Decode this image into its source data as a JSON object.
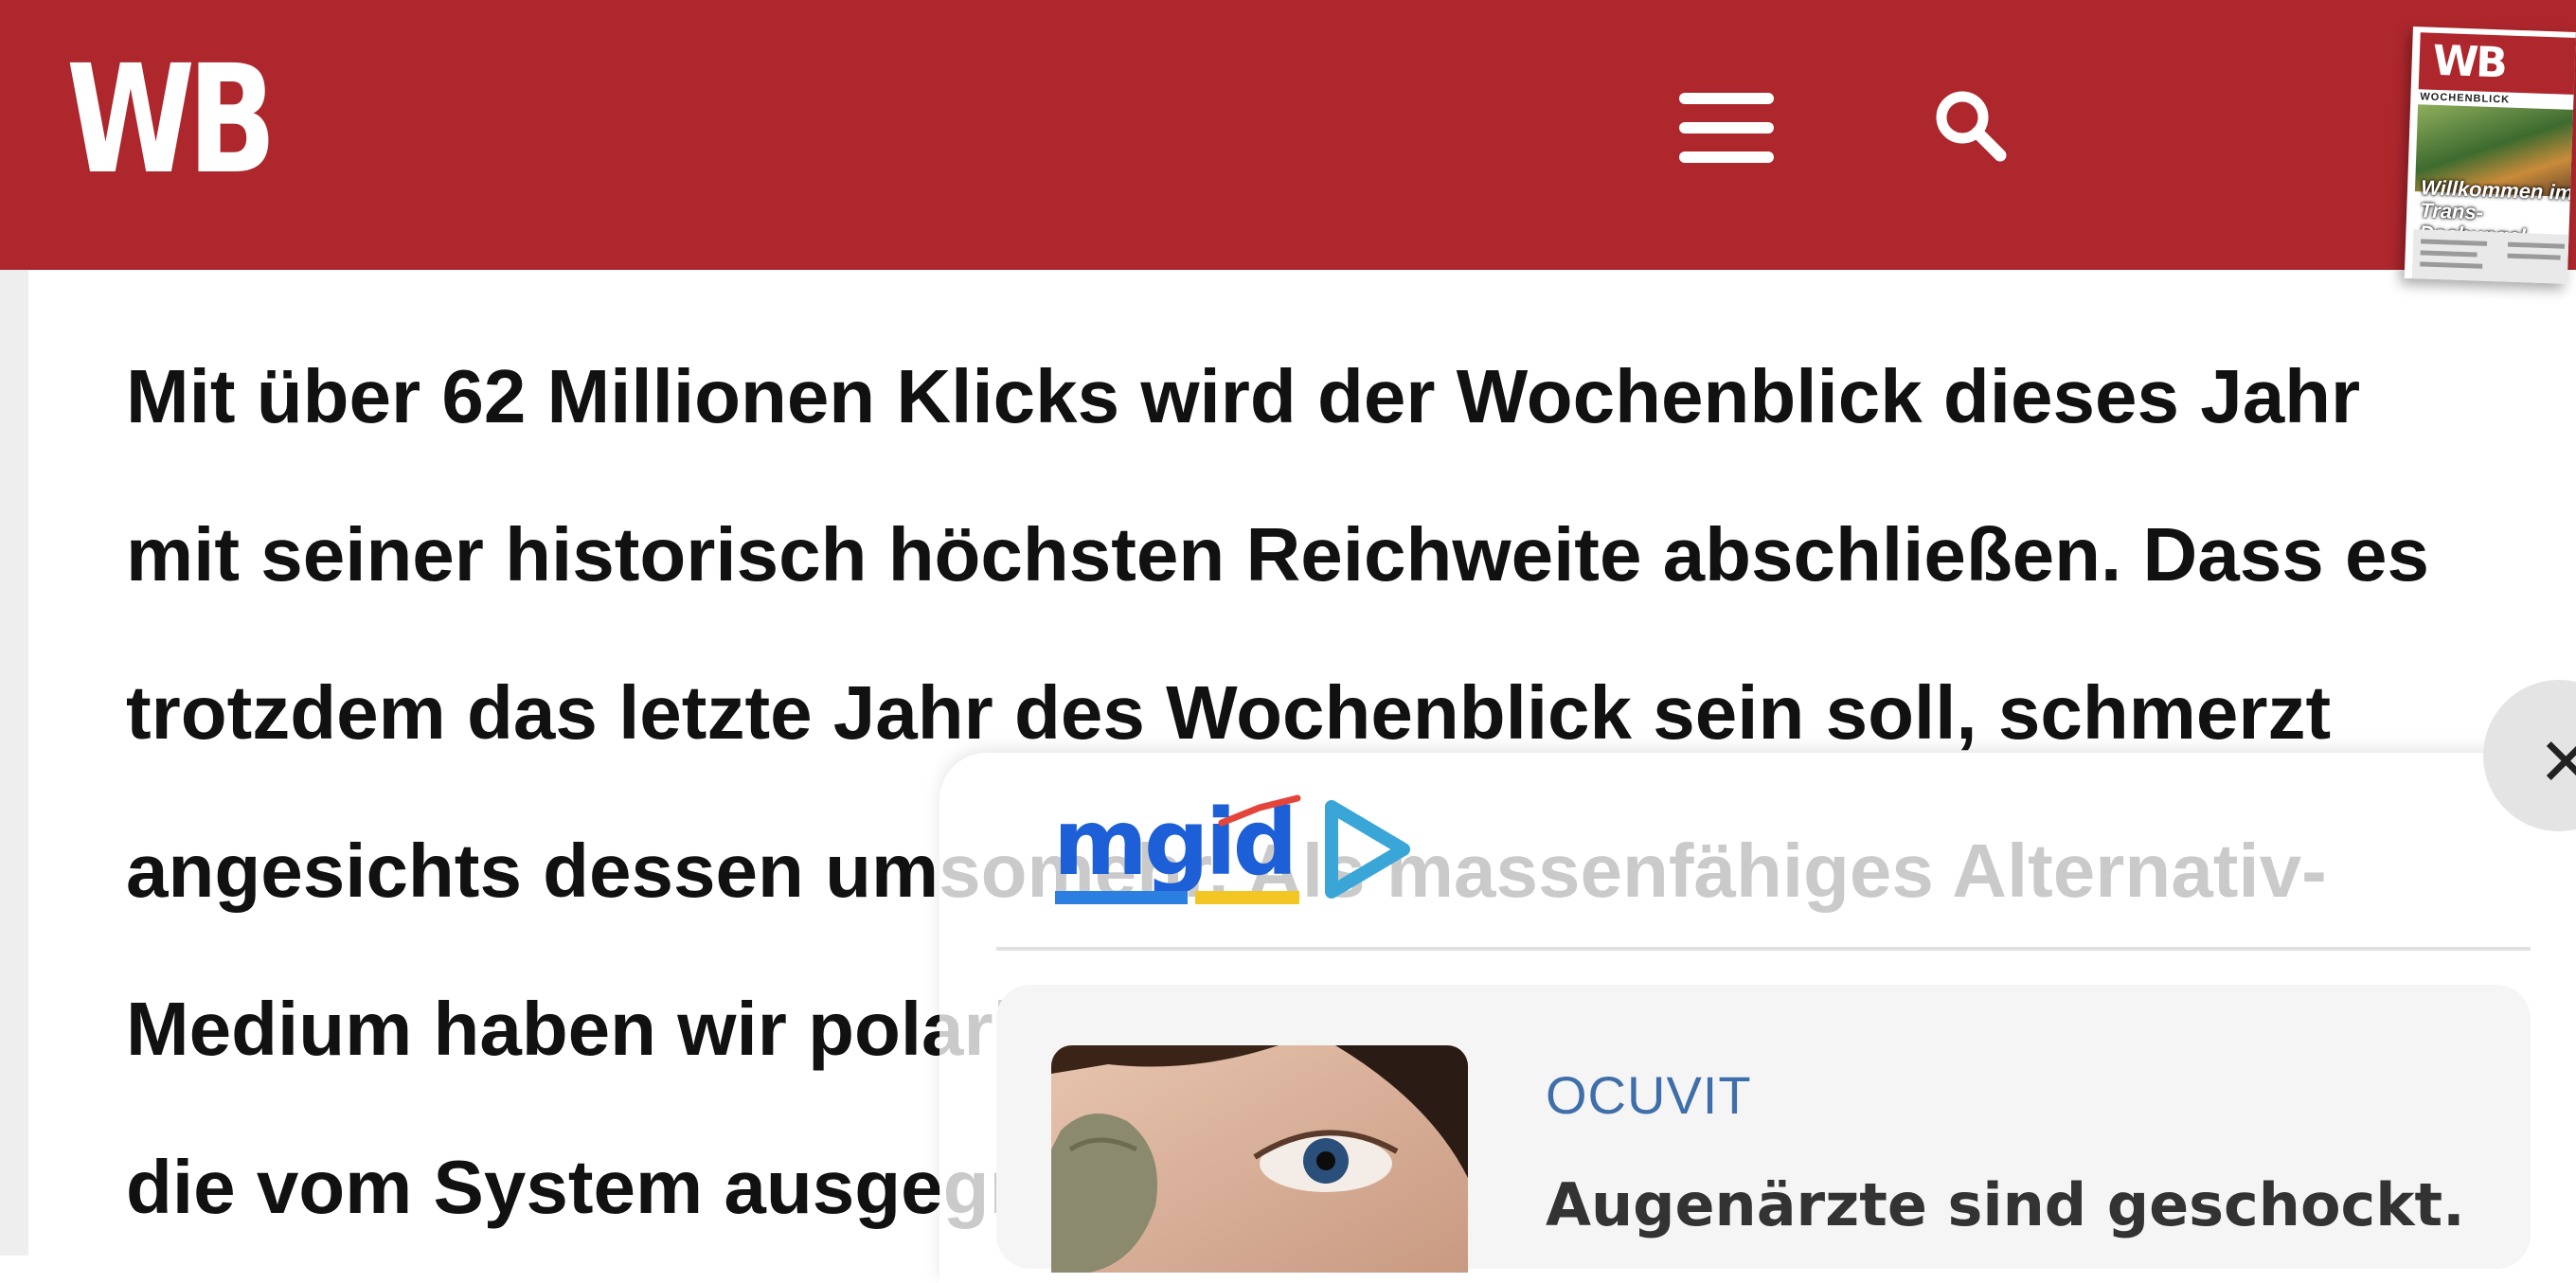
{
  "header": {
    "logo_text": "WB",
    "menu_icon": "hamburger-menu-icon",
    "search_icon": "search-icon",
    "brand_color": "#ae272d"
  },
  "magazine": {
    "logo_text": "WB",
    "subtitle": "WOCHENBLICK",
    "headline": "Willkommen im Trans-Dschungel"
  },
  "article": {
    "lines": [
      "Mit über 62 Millionen Klicks wird der Wochenblick dieses Jahr",
      "mit seiner historisch höchsten Reichweite abschließen. Dass es",
      "trotzdem das letzte Jahr des Wochenblick sein soll, schmerzt",
      "angesichts dessen umsomehr. Als massenfähiges Alternativ-",
      "Medium haben wir polarisiert und jenen eine Stimme gegeben,",
      "die vom System ausgegrenzt"
    ]
  },
  "ad": {
    "network_logo": "mgid",
    "close_icon": "close-icon",
    "card": {
      "brand": "OCUVIT",
      "title": "Augenärzte sind geschockt."
    }
  }
}
